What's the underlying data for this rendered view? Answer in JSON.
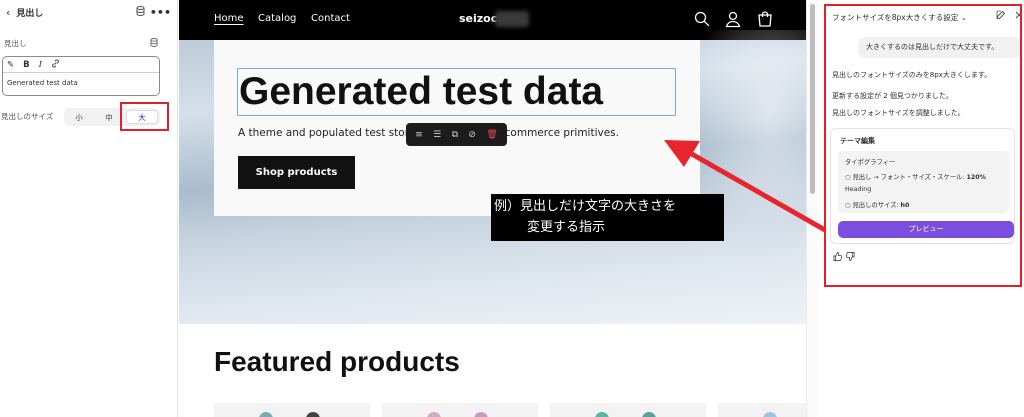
{
  "left_panel": {
    "back_icon": "chevron-left-icon",
    "title": "見出し",
    "db_icon": "database-icon",
    "more_icon": "ellipsis-icon",
    "field_label": "見出し",
    "toolbar": {
      "magic_icon": "sparkle-icon",
      "bold": "B",
      "italic": "I",
      "link_icon": "link-icon"
    },
    "field_value": "Generated test data",
    "size_label": "見出しのサイズ",
    "size_options": [
      "小",
      "中",
      "大"
    ],
    "size_selected": "大"
  },
  "preview": {
    "nav": {
      "links": [
        "Home",
        "Catalog",
        "Contact"
      ],
      "active": "Home",
      "brand": "seizoc",
      "icons": [
        "search-icon",
        "account-icon",
        "cart-icon"
      ]
    },
    "hero": {
      "heading": "Generated test data",
      "subtitle": "A theme and populated test store  to help you test commerce primitives.",
      "button": "Shop products"
    },
    "floating_toolbar_icons": [
      "align-icon",
      "list-icon",
      "duplicate-icon",
      "hide-icon",
      "delete-icon"
    ],
    "annotation": {
      "line1": "例）見出しだけ文字の大きさを",
      "line2": "変更する指示"
    },
    "featured_title": "Featured products"
  },
  "chat": {
    "title": "フォントサイズを8px大きくする設定",
    "title_caret": "⌄",
    "edit_icon": "edit-icon",
    "close_icon": "close-icon",
    "user_message": "大きくするのは見出しだけで大丈夫です。",
    "messages": [
      "見出しのフォントサイズのみを8px大きくします。",
      "更新する設定が 2 個見つかりました。",
      "見出しのフォントサイズを調整しました。"
    ],
    "theme_card": {
      "title": "テーマ編集",
      "section": "タイポグラフィー",
      "item1_label": "見出し → フォント・サイズ・スケール:",
      "item1_value": "120%",
      "section2": "Heading",
      "item2_label": "見出しのサイズ:",
      "item2_value": "h0",
      "preview_button": "プレビュー"
    },
    "feedback_icons": [
      "thumbs-up-icon",
      "thumbs-down-icon"
    ]
  },
  "colors": {
    "highlight_red": "#e0202a",
    "accent_purple": "#7b4ee0",
    "selected_text": "#2c2ccf"
  }
}
